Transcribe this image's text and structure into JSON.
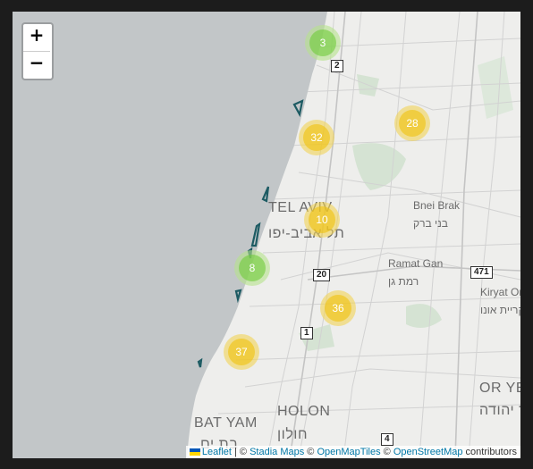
{
  "map": {
    "colors": {
      "sea": "#c2c6c8",
      "land": "#eeeeec",
      "roads": "#cfcfcf",
      "parks": "#d5e3d3",
      "markers": "#1d5b63"
    },
    "zoom_in_label": "+",
    "zoom_out_label": "−",
    "clusters": [
      {
        "count": "3",
        "size": "small"
      },
      {
        "count": "32",
        "size": "medium"
      },
      {
        "count": "28",
        "size": "medium"
      },
      {
        "count": "10",
        "size": "medium"
      },
      {
        "count": "8",
        "size": "small"
      },
      {
        "count": "36",
        "size": "medium"
      },
      {
        "count": "37",
        "size": "medium"
      }
    ],
    "places": {
      "tel_aviv": "TEL AVIV",
      "tel_aviv_he": "תל אביב-יפו",
      "bnei_brak": "Bnei Brak",
      "bnei_brak_he": "בני ברק",
      "ramat_gan": "Ramat Gan",
      "ramat_gan_he": "רמת גן",
      "kiryat_ono": "Kiryat On",
      "kiryat_ono_he": "קריית אונו",
      "or_yehuda": "OR YEH",
      "or_yehuda_he": "אור יהודה",
      "holon": "HOLON",
      "holon_he": "חולון",
      "bat_yam": "BAT YAM",
      "bat_yam_he": "בת ים"
    },
    "road_shields": {
      "r2": "2",
      "r20": "20",
      "r471": "471",
      "r1": "1",
      "r4": "4"
    },
    "attribution": {
      "leaflet": "Leaflet",
      "sep1": " | © ",
      "stadia": "Stadia Maps",
      "sep2": " © ",
      "omt": "OpenMapTiles",
      "sep3": " © ",
      "osm": "OpenStreetMap",
      "suffix": " contributors"
    }
  }
}
